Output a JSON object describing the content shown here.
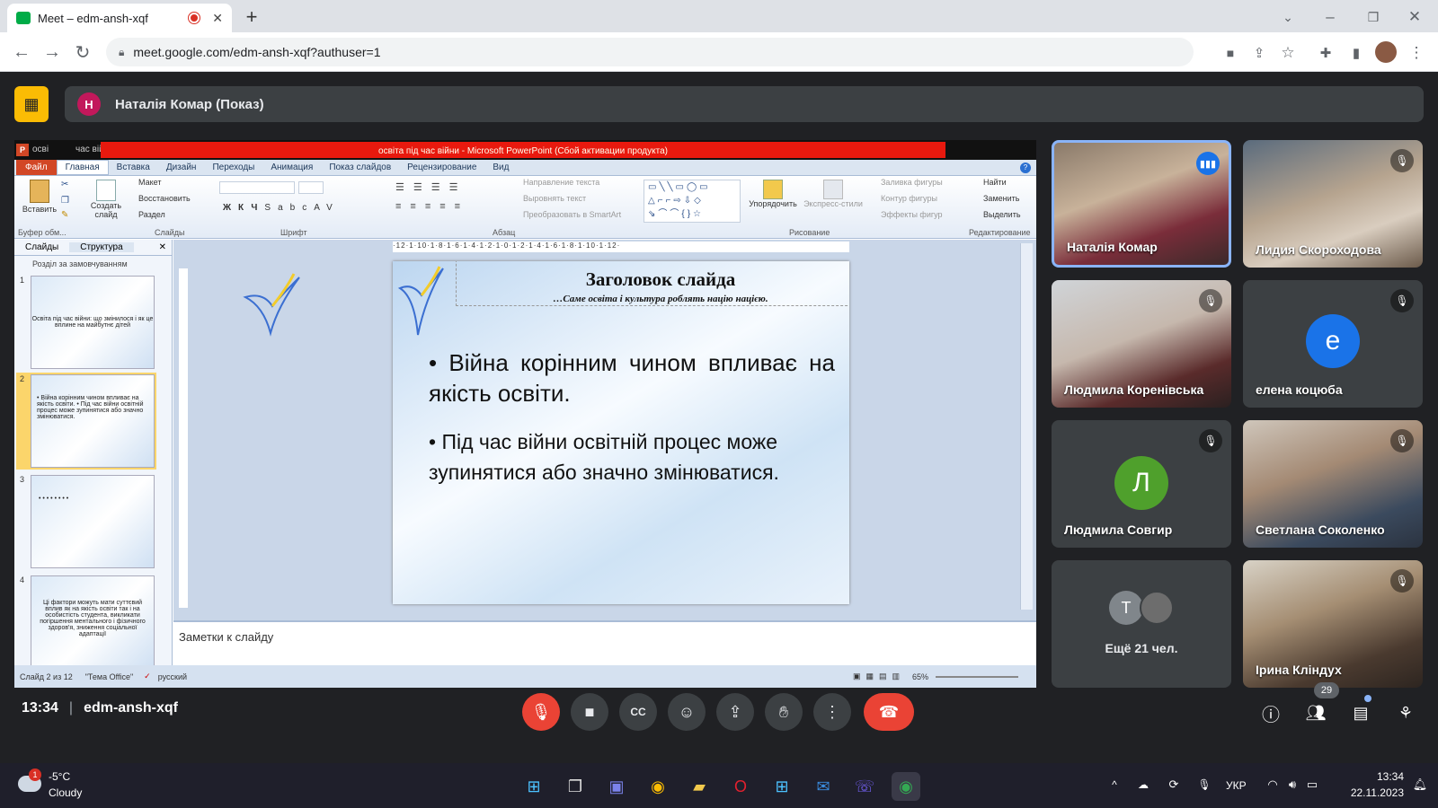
{
  "browser": {
    "tab_title": "Meet – edm-ansh-xqf",
    "url": "meet.google.com/edm-ansh-xqf?authuser=1"
  },
  "meet": {
    "presenter_initial": "Н",
    "presenter_label": "Наталія Комар (Показ)",
    "time": "13:34",
    "meeting_code": "edm-ansh-xqf",
    "participants_count": "29",
    "participants": [
      {
        "name": "Наталія Комар"
      },
      {
        "name": "Лидия Скороходова"
      },
      {
        "name": "Людмила Коренівська"
      },
      {
        "name": "елена коцюба",
        "initial": "е"
      },
      {
        "name": "Людмила Совгир",
        "initial": "Л"
      },
      {
        "name": "Светлана Соколенко"
      },
      {
        "name": "Ещё 21 чел.",
        "initial": "Т"
      },
      {
        "name": "Ірина Кліндух"
      }
    ],
    "colors": {
      "end_call": "#ea4335",
      "mic_off": "#ea4335",
      "avatar_e": "#1a73e8",
      "avatar_l": "#4fa02c"
    }
  },
  "ppt": {
    "title_left": "осві",
    "title_left2": "час війн",
    "window_title": "освіта під час війни - Microsoft PowerPoint (Сбой активации продукта)",
    "tabs": [
      "Файл",
      "Главная",
      "Вставка",
      "Дизайн",
      "Переходы",
      "Анимация",
      "Показ слайдов",
      "Рецензирование",
      "Вид"
    ],
    "clipboard": {
      "paste": "Вставить",
      "label": "Буфер обм..."
    },
    "slides_group": {
      "create": "Создать слайд",
      "layout": "Макет",
      "reset": "Восстановить",
      "section": "Раздел",
      "label": "Слайды"
    },
    "font_label": "Шрифт",
    "paragraph": {
      "dir": "Направление текста",
      "align": "Выровнять текст",
      "smartart": "Преобразовать в SmartArt",
      "label": "Абзац"
    },
    "drawing": {
      "arrange": "Упорядочить",
      "quick": "Экспресс-стили",
      "fill": "Заливка фигуры",
      "outline": "Контур фигуры",
      "effects": "Эффекты фигур",
      "label": "Рисование"
    },
    "editing": {
      "find": "Найти",
      "replace": "Заменить",
      "select": "Выделить",
      "label": "Редактирование"
    },
    "pane_tabs": [
      "Слайды",
      "Структура"
    ],
    "section_name": "Розділ за замовчуванням",
    "thumbs": [
      {
        "n": "1",
        "text": "Освіта під час війни: що змінилося і як це вплине на майбутнє дітей"
      },
      {
        "n": "2",
        "text": "• Війна корінним чином впливає на якість освіти. • Під час війни освітній процес може зупинятися або значно змінюватися."
      },
      {
        "n": "3",
        "text": "• • • • • • • •"
      },
      {
        "n": "4",
        "text": "Ці фактори можуть мати суттєвий вплив як на якість освіти так і на особистість студента, викликати погіршення ментального і фізичного здоров'я, зниження соціальної адаптації"
      }
    ],
    "ruler": "·12·1·10·1·8·1·6·1·4·1·2·1·0·1·2·1·4·1·6·1·8·1·10·1·12·",
    "slide": {
      "title": "Заголовок слайда",
      "subtitle": "…Саме освіта і культура роблять націю нацією.",
      "bullet1": "• Війна корінним чином впливає на якість освіти.",
      "bullet2": "• Під час війни освітній процес може зупинятися або значно змінюватися."
    },
    "notes": "Заметки к слайду",
    "status": {
      "slide": "Слайд 2 из 12",
      "theme": "\"Тема Office\"",
      "lang": "русский",
      "zoom": "65%"
    }
  },
  "taskbar": {
    "weather_badge": "1",
    "temp": "-5°C",
    "weather": "Cloudy",
    "lang": "УКР",
    "time": "13:34",
    "date": "22.11.2023"
  }
}
